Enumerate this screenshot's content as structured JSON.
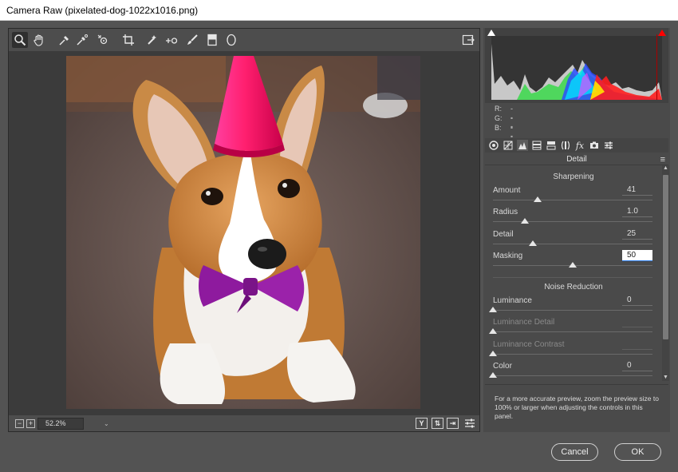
{
  "window": {
    "title": "Camera Raw (pixelated-dog-1022x1016.png)"
  },
  "toolbar": {
    "tools": [
      "zoom-icon",
      "hand-icon",
      "white-balance-icon",
      "color-sampler-icon",
      "targeted-adjustment-icon",
      "crop-icon",
      "spot-removal-icon",
      "red-eye-icon",
      "adjustment-brush-icon",
      "graduated-filter-icon",
      "radial-filter-icon"
    ],
    "export_icon": "open-preferences-icon"
  },
  "preview": {
    "zoom_value": "52.2%",
    "zoom_minus": "−",
    "zoom_plus": "+",
    "view_buttons": [
      "Y",
      "⇅",
      "⇥"
    ]
  },
  "histogram": {
    "clip_shadow_color": "#ffffff",
    "clip_highlight_color": "#ff0000"
  },
  "readout": {
    "r_label": "R:",
    "r_value": "---",
    "g_label": "G:",
    "g_value": "---",
    "b_label": "B:",
    "b_value": "---"
  },
  "panel": {
    "title": "Detail",
    "tabs": [
      "basic-icon",
      "tone-curve-icon",
      "detail-icon",
      "hsl-icon",
      "split-toning-icon",
      "lens-corrections-icon",
      "effects-icon",
      "camera-calibration-icon",
      "presets-icon"
    ],
    "tab_fx_label": "fx",
    "sharpening": {
      "title": "Sharpening",
      "amount": {
        "label": "Amount",
        "value": "41",
        "fraction": 0.28
      },
      "radius": {
        "label": "Radius",
        "value": "1.0",
        "fraction": 0.2
      },
      "detail": {
        "label": "Detail",
        "value": "25",
        "fraction": 0.25
      },
      "masking": {
        "label": "Masking",
        "value": "50",
        "fraction": 0.5
      }
    },
    "noise_reduction": {
      "title": "Noise Reduction",
      "luminance": {
        "label": "Luminance",
        "value": "0",
        "fraction": 0
      },
      "luminance_detail": {
        "label": "Luminance Detail",
        "value": "",
        "fraction": 0
      },
      "luminance_contrast": {
        "label": "Luminance Contrast",
        "value": "",
        "fraction": 0
      },
      "color": {
        "label": "Color",
        "value": "0",
        "fraction": 0
      }
    },
    "hint": "For a more accurate preview, zoom the preview size to 100% or larger when adjusting the controls in this panel."
  },
  "footer": {
    "cancel_label": "Cancel",
    "ok_label": "OK"
  }
}
